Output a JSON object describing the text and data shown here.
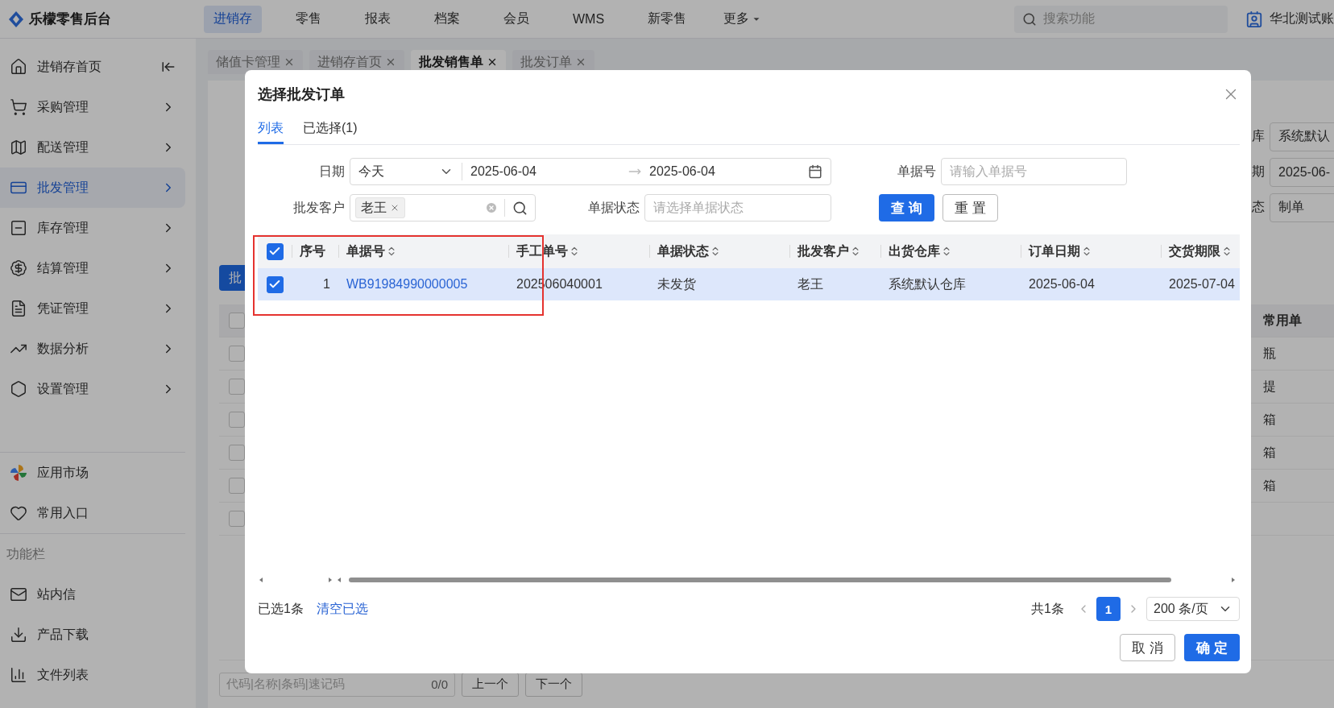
{
  "app": {
    "name": "乐檬零售后台"
  },
  "top_nav": [
    {
      "label": "进销存",
      "selected": true
    },
    {
      "label": "零售",
      "selected": false
    },
    {
      "label": "报表",
      "selected": false
    },
    {
      "label": "档案",
      "selected": false
    },
    {
      "label": "会员",
      "selected": false
    },
    {
      "label": "WMS",
      "selected": false
    },
    {
      "label": "新零售",
      "selected": false
    }
  ],
  "more_menu": {
    "label": "更多"
  },
  "search": {
    "placeholder": "搜索功能"
  },
  "account": {
    "label": "华北测试账"
  },
  "sidebar": {
    "items": [
      {
        "label": "进销存首页",
        "selected": false,
        "kind": "home"
      },
      {
        "label": "采购管理",
        "selected": false,
        "kind": "group"
      },
      {
        "label": "配送管理",
        "selected": false,
        "kind": "group"
      },
      {
        "label": "批发管理",
        "selected": true,
        "kind": "group"
      },
      {
        "label": "库存管理",
        "selected": false,
        "kind": "group"
      },
      {
        "label": "结算管理",
        "selected": false,
        "kind": "group"
      },
      {
        "label": "凭证管理",
        "selected": false,
        "kind": "group"
      },
      {
        "label": "数据分析",
        "selected": false,
        "kind": "group"
      },
      {
        "label": "设置管理",
        "selected": false,
        "kind": "group"
      }
    ],
    "shortcuts": [
      {
        "label": "应用市场"
      },
      {
        "label": "常用入口"
      }
    ],
    "section_title": "功能栏",
    "tools": [
      {
        "label": "站内信"
      },
      {
        "label": "产品下载"
      },
      {
        "label": "文件列表"
      }
    ]
  },
  "page_tabs": [
    {
      "label": "储值卡管理",
      "selected": false
    },
    {
      "label": "进销存首页",
      "selected": false
    },
    {
      "label": "批发销售单",
      "selected": true
    },
    {
      "label": "批发订单",
      "selected": false
    }
  ],
  "background_form": {
    "fields": [
      {
        "label": "库",
        "value": "系统默认"
      },
      {
        "label": "期",
        "value": "2025-06-"
      },
      {
        "label": "态",
        "value": "制单"
      }
    ],
    "action_button": "批",
    "table_header": "常用单",
    "header_checked": false,
    "rows": [
      {
        "checked": false,
        "unit": "瓶"
      },
      {
        "checked": false,
        "unit": "提"
      },
      {
        "checked": false,
        "unit": "箱"
      },
      {
        "checked": false,
        "unit": "箱"
      },
      {
        "checked": false,
        "unit": "箱"
      },
      {
        "checked": false
      }
    ],
    "search_placeholder": "代码|名称|条码|速记码",
    "counter": "0/0",
    "prev_button": "上一个",
    "next_button": "下一个"
  },
  "dialog": {
    "title": "选择批发订单",
    "tabs": [
      {
        "label": "列表",
        "selected": true
      },
      {
        "label": "已选择(1)",
        "selected": false
      }
    ],
    "filters": {
      "date": {
        "label": "日期",
        "preset": "今天",
        "start": "2025-06-04",
        "end": "2025-06-04"
      },
      "doc_no": {
        "label": "单据号",
        "placeholder": "请输入单据号"
      },
      "customer": {
        "label": "批发客户",
        "tags": [
          "老王"
        ]
      },
      "status": {
        "label": "单据状态",
        "placeholder": "请选择单据状态"
      },
      "query_button": "查 询",
      "reset_button": "重 置"
    },
    "table": {
      "select_all": {
        "checked": true
      },
      "columns": [
        {
          "label": "序号",
          "sortable": false
        },
        {
          "label": "单据号",
          "sortable": true
        },
        {
          "label": "手工单号",
          "sortable": true
        },
        {
          "label": "单据状态",
          "sortable": true
        },
        {
          "label": "批发客户",
          "sortable": true
        },
        {
          "label": "出货仓库",
          "sortable": true
        },
        {
          "label": "订单日期",
          "sortable": true
        },
        {
          "label": "交货期限",
          "sortable": true
        }
      ],
      "rows": [
        {
          "checked": true,
          "selected": true,
          "cells": [
            "1",
            "WB91984990000005",
            "202506040001",
            "未发货",
            "老王",
            "系统默认仓库",
            "2025-06-04",
            "2025-07-04"
          ]
        }
      ]
    },
    "footer": {
      "selected_text": "已选1条",
      "clear_link": "清空已选",
      "total": "共1条",
      "pages": [
        {
          "label": "1",
          "selected": true
        }
      ],
      "page_size": "200 条/页"
    },
    "cancel_button": "取 消",
    "confirm_button": "确 定"
  }
}
